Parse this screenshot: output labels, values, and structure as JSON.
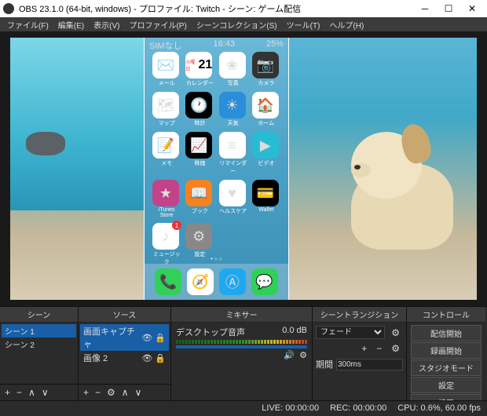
{
  "titlebar": {
    "title": "OBS 23.1.0 (64-bit, windows) - プロファイル: Twitch - シーン: ゲーム配信"
  },
  "menu": [
    "ファイル(F)",
    "編集(E)",
    "表示(V)",
    "プロファイル(P)",
    "シーンコレクション(S)",
    "ツール(T)",
    "ヘルプ(H)"
  ],
  "phone": {
    "carrier": "SIMなし",
    "time": "16:43",
    "battery": "25%",
    "apps": [
      {
        "l": "メール",
        "c": "#fff",
        "i": "✉️"
      },
      {
        "l": "カレンダー",
        "c": "#fff",
        "i": "21",
        "sub": "火曜日"
      },
      {
        "l": "写真",
        "c": "#fff",
        "i": "❀"
      },
      {
        "l": "カメラ",
        "c": "#333",
        "i": "📷"
      },
      {
        "l": "マップ",
        "c": "#fff",
        "i": "🗺"
      },
      {
        "l": "時計",
        "c": "#000",
        "i": "🕐"
      },
      {
        "l": "天気",
        "c": "#2a8fd8",
        "i": "☀"
      },
      {
        "l": "ホーム",
        "c": "#fff",
        "i": "🏠"
      },
      {
        "l": "メモ",
        "c": "#fff",
        "i": "📝"
      },
      {
        "l": "株価",
        "c": "#000",
        "i": "📈"
      },
      {
        "l": "リマインダー",
        "c": "#fff",
        "i": "≡"
      },
      {
        "l": "ビデオ",
        "c": "#28bcd4",
        "i": "▶"
      },
      {
        "l": "iTunes Store",
        "c": "#c3428a",
        "i": "★"
      },
      {
        "l": "ブック",
        "c": "#f58220",
        "i": "📖"
      },
      {
        "l": "ヘルスケア",
        "c": "#fff",
        "i": "♥"
      },
      {
        "l": "Wallet",
        "c": "#000",
        "i": "💳"
      },
      {
        "l": "ミュージック",
        "c": "#fff",
        "i": "♪",
        "badge": "1"
      },
      {
        "l": "設定",
        "c": "#888",
        "i": "⚙"
      }
    ],
    "dock": [
      {
        "c": "#30d158",
        "i": "📞"
      },
      {
        "c": "#fff",
        "i": "🧭"
      },
      {
        "c": "#1fa8f0",
        "i": "Ⓐ"
      },
      {
        "c": "#30d158",
        "i": "💬"
      }
    ]
  },
  "panels": {
    "scenes": {
      "title": "シーン",
      "items": [
        "シーン 1",
        "シーン 2"
      ]
    },
    "sources": {
      "title": "ソース",
      "items": [
        "画面キャプチャ",
        "画像 2"
      ]
    },
    "mixer": {
      "title": "ミキサー",
      "ch": "デスクトップ音声",
      "db": "0.0 dB"
    },
    "transitions": {
      "title": "シーントランジション",
      "type": "フェード",
      "duration_label": "期間",
      "duration": "300ms"
    },
    "controls": {
      "title": "コントロール",
      "buttons": [
        "配信開始",
        "録画開始",
        "スタジオモード",
        "設定",
        "終了"
      ]
    }
  },
  "status": {
    "live": "LIVE: 00:00:00",
    "rec": "REC: 00:00:00",
    "cpu": "CPU: 0.6%, 60.00 fps"
  }
}
